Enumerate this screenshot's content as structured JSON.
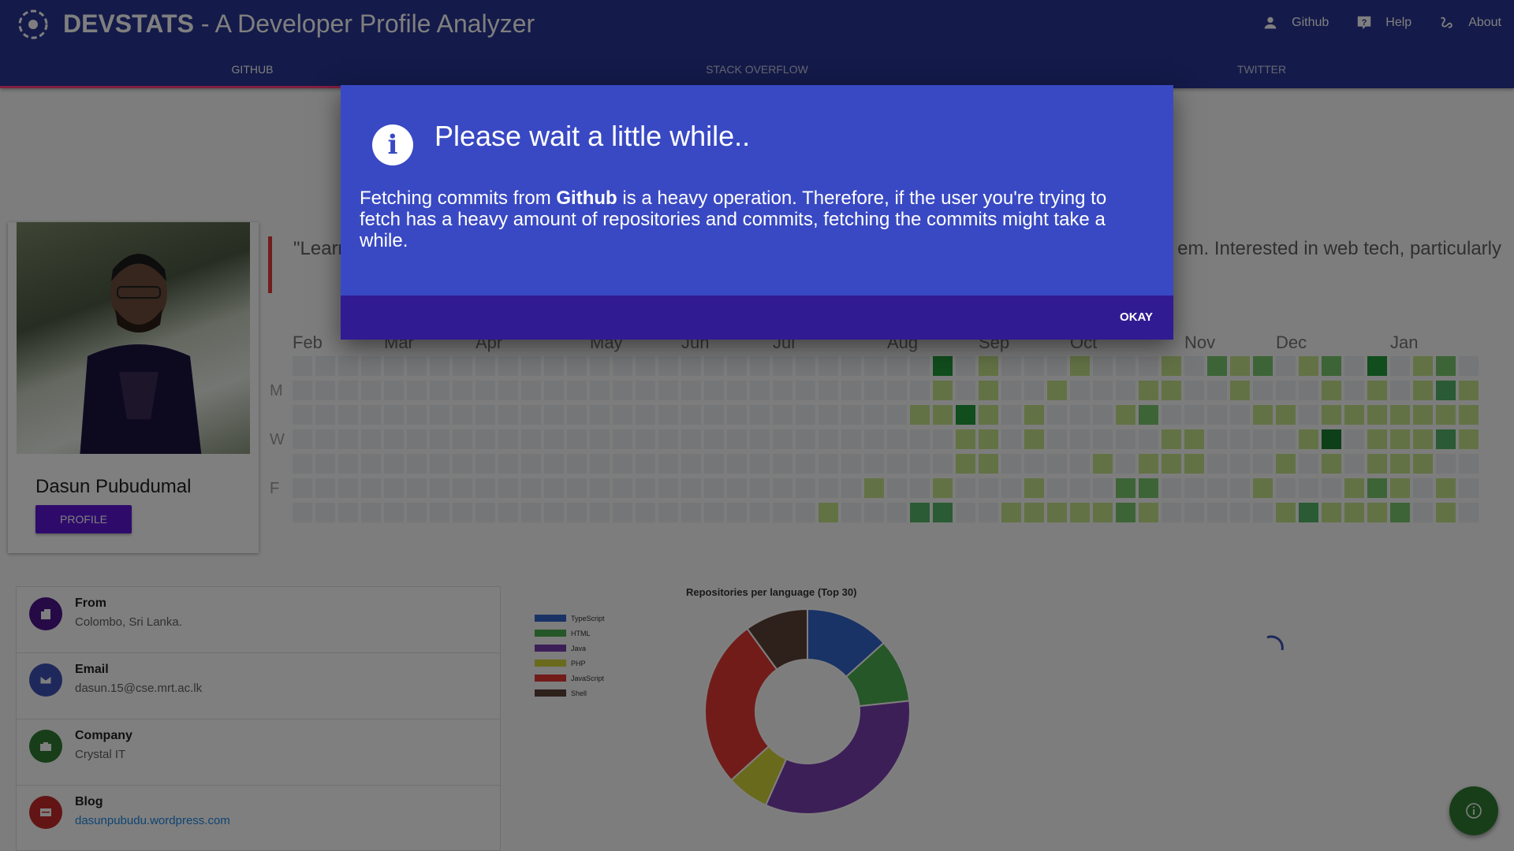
{
  "app": {
    "title_bold": "DEVSTATS",
    "title_rest": " - A Developer Profile Analyzer",
    "nav": [
      {
        "label": "Github",
        "icon": "person-icon"
      },
      {
        "label": "Help",
        "icon": "help-icon"
      },
      {
        "label": "About",
        "icon": "about-icon"
      }
    ],
    "tabs": [
      "GITHUB",
      "STACK OVERFLOW",
      "TWITTER"
    ],
    "active_tab": "GITHUB",
    "accent_color": "#283593"
  },
  "profile": {
    "name": "Dasun Pubudumal",
    "button": "PROFILE"
  },
  "quote": {
    "left": "\"Learn",
    "right": "em. Interested in web tech, particularly"
  },
  "heatmap": {
    "months": [
      "Feb",
      "Mar",
      "Apr",
      "May",
      "Jun",
      "Jul",
      "Aug",
      "Sep",
      "Oct",
      "Nov",
      "Dec",
      "Jan"
    ],
    "day_labels": [
      "M",
      "W",
      "F"
    ],
    "levels": [
      "0000000000000000000000000000401000100010212012040120",
      "0000000000000000000000000000101001000110010001010131",
      "0000000000000000000000000001141010001200001101111111",
      "0000000000000000000000000000011010000011000015011131",
      "0000000000000000000000000000011000010111000101011100",
      "0000000000000000000000000100100010002200001000121010",
      "0000000000000000000000010003300111112100000131112010"
    ]
  },
  "info": [
    {
      "label": "From",
      "value": "Colombo, Sri Lanka.",
      "icon": "building-icon",
      "color": "#4a148c"
    },
    {
      "label": "Email",
      "value": "dasun.15@cse.mrt.ac.lk",
      "icon": "email-icon",
      "color": "#3f51b5"
    },
    {
      "label": "Company",
      "value": "Crystal IT",
      "icon": "briefcase-icon",
      "color": "#2e7d32"
    },
    {
      "label": "Blog",
      "value": "dasunpubudu.wordpress.com",
      "icon": "web-icon",
      "color": "#c62828"
    }
  ],
  "chart_data": {
    "type": "pie",
    "title": "Repositories per language (Top 30)",
    "categories": [
      "TypeScript",
      "HTML",
      "Java",
      "PHP",
      "JavaScript",
      "Shell"
    ],
    "values": [
      4,
      3,
      10,
      2,
      8,
      3
    ],
    "colors": [
      "#3366cc",
      "#4caf50",
      "#7b3fb0",
      "#d4d43a",
      "#e53935",
      "#5d4037"
    ],
    "legend_position": "left"
  },
  "dialog": {
    "title": "Please wait a little while..",
    "body_pre": "Fetching commits from ",
    "body_bold": "Github",
    "body_post": " is a heavy operation. Therefore, if the user you're trying to fetch has a heavy amount of repositories and commits, fetching the commits might take a while.",
    "button": "OKAY"
  }
}
